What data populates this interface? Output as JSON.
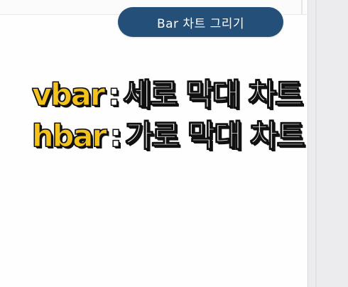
{
  "header": {
    "title": "Bar 차트 그리기"
  },
  "captions": [
    {
      "keyword": "vbar",
      "separator": ":",
      "description": "세로 막대 차트"
    },
    {
      "keyword": "hbar",
      "separator": ":",
      "description": "가로 막대 차트"
    }
  ],
  "colors": {
    "pill_background": "#234f78",
    "keyword_color": "#f3c21c",
    "text_outline": "#111111"
  }
}
